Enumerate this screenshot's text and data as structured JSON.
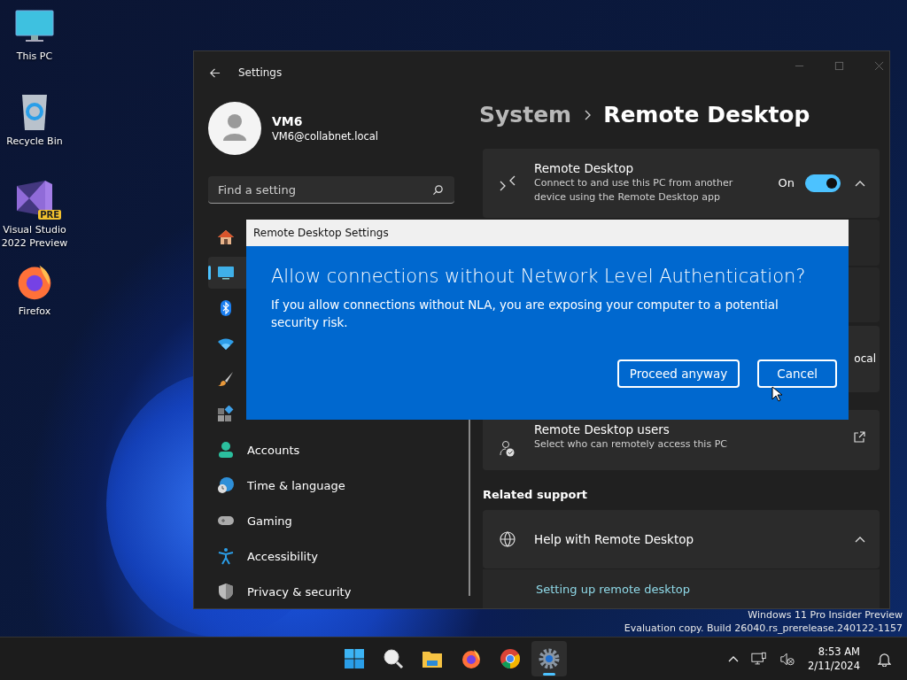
{
  "desktop_icons": [
    {
      "kind": "pc",
      "label": "This PC"
    },
    {
      "kind": "bin",
      "label": "Recycle Bin"
    },
    {
      "kind": "vs",
      "label": "Visual Studio 2022 Preview",
      "badge": "PRE"
    },
    {
      "kind": "firefox",
      "label": "Firefox"
    }
  ],
  "settings_window": {
    "title": "Settings",
    "user": {
      "name": "VM6",
      "email": "VM6@collabnet.local"
    },
    "search": {
      "placeholder": "Find a setting"
    },
    "nav_items": [
      {
        "kind": "home",
        "selected": false
      },
      {
        "kind": "system",
        "selected": true
      },
      {
        "kind": "bluetooth",
        "selected": false
      },
      {
        "kind": "network",
        "selected": false
      },
      {
        "kind": "personalization",
        "selected": false
      },
      {
        "kind": "apps",
        "selected": false
      },
      {
        "kind": "accounts",
        "label": "Accounts",
        "selected": false
      },
      {
        "kind": "time",
        "label": "Time & language",
        "selected": false
      },
      {
        "kind": "gaming",
        "label": "Gaming",
        "selected": false
      },
      {
        "kind": "accessibility",
        "label": "Accessibility",
        "selected": false
      },
      {
        "kind": "privacy",
        "label": "Privacy & security",
        "selected": false
      }
    ],
    "breadcrumb": [
      "System",
      "Remote Desktop"
    ],
    "remote_desktop": {
      "title": "Remote Desktop",
      "description": "Connect to and use this PC from another device using the Remote Desktop app",
      "state_label": "On",
      "on": true,
      "expanded": true
    },
    "pc_name_row": {
      "value": "ocal"
    },
    "users_card": {
      "title": "Remote Desktop users",
      "description": "Select who can remotely access this PC"
    },
    "related_support": {
      "heading": "Related support",
      "title": "Help with Remote Desktop",
      "expanded": true,
      "link": "Setting up remote desktop"
    }
  },
  "dialog": {
    "title": "Remote Desktop Settings",
    "heading": "Allow connections without Network Level Authentication?",
    "message": "If you allow connections without NLA, you are exposing your computer to a potential security risk.",
    "buttons": [
      "Proceed anyway",
      "Cancel"
    ]
  },
  "desktop_text": [
    "Windows 11 Pro Insider Preview",
    "Evaluation copy. Build 26040.rs_prerelease.240122-1157"
  ],
  "taskbar": {
    "apps": [
      {
        "kind": "start",
        "selected": false
      },
      {
        "kind": "search",
        "selected": false
      },
      {
        "kind": "explorer",
        "selected": false
      },
      {
        "kind": "firefox",
        "selected": false
      },
      {
        "kind": "chrome",
        "selected": false
      },
      {
        "kind": "settings",
        "selected": true
      }
    ],
    "time": "8:53 AM",
    "date": "2/11/2024"
  }
}
